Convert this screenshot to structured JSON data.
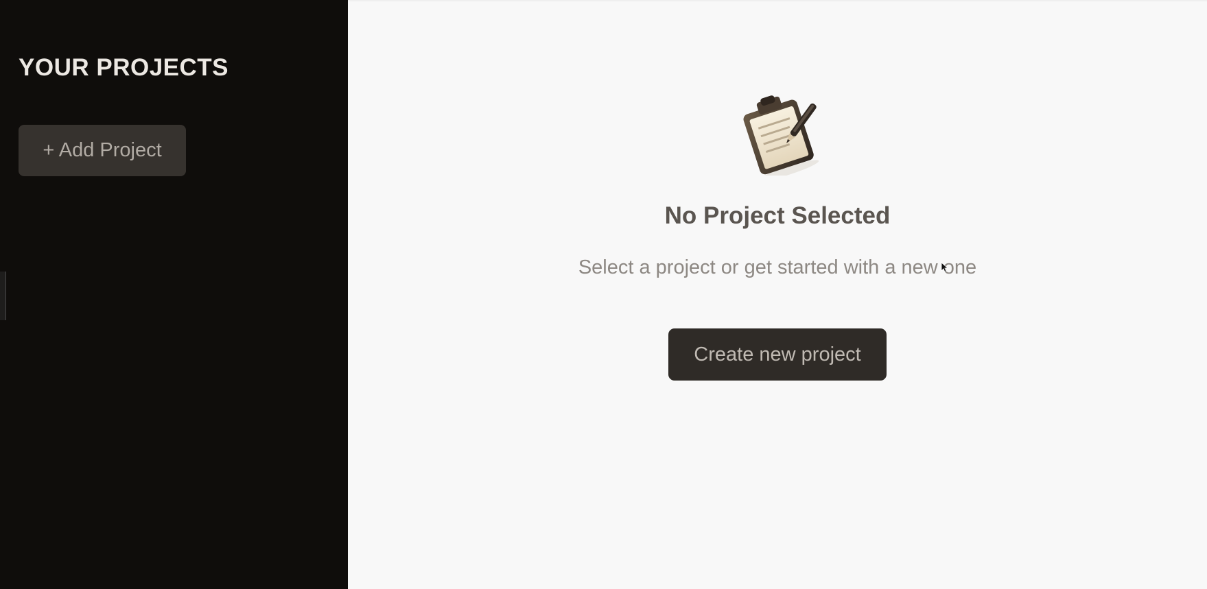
{
  "sidebar": {
    "title": "YOUR PROJECTS",
    "add_button_label": "+ Add Project"
  },
  "main": {
    "empty_state": {
      "icon": "clipboard-icon",
      "title": "No Project Selected",
      "subtitle": "Select a project or get started with a new one",
      "button_label": "Create new project"
    }
  },
  "colors": {
    "sidebar_bg": "#0f0d0b",
    "main_bg": "#f8f8f8",
    "button_dark": "#2f2b27",
    "sidebar_button": "#36322e"
  }
}
